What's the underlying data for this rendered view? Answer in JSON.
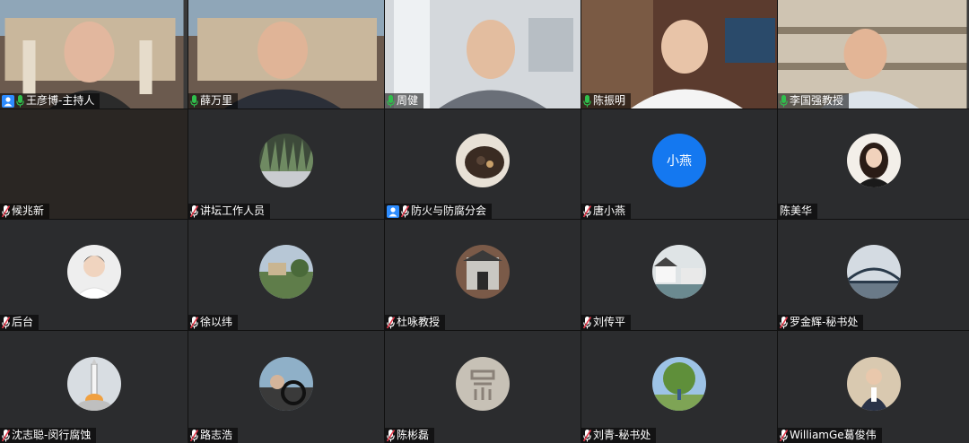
{
  "participants": [
    {
      "name": "王彦博-主持人",
      "kind": "video",
      "host": true,
      "mic": "on"
    },
    {
      "name": "薛万里",
      "kind": "video",
      "mic": "on",
      "active": true
    },
    {
      "name": "周健",
      "kind": "video",
      "mic": "on"
    },
    {
      "name": "陈振明",
      "kind": "video",
      "mic": "on"
    },
    {
      "name": "李国强教授",
      "kind": "video",
      "mic": "on"
    },
    {
      "name": "候兆新",
      "kind": "blank",
      "mic": "off"
    },
    {
      "name": "讲坛工作人员",
      "kind": "avatar",
      "avatar": "grass",
      "mic": "off"
    },
    {
      "name": "防火与防腐分会",
      "kind": "avatar",
      "avatar": "hair",
      "host": true,
      "mic": "off"
    },
    {
      "name": "唐小燕",
      "kind": "avatar",
      "avatar": "text",
      "avatar_text": "小燕",
      "mic": "off"
    },
    {
      "name": "陈美华",
      "kind": "avatar",
      "avatar": "woman",
      "mic": "none"
    },
    {
      "name": "后台",
      "kind": "avatar",
      "avatar": "man",
      "mic": "off"
    },
    {
      "name": "徐以纬",
      "kind": "avatar",
      "avatar": "park",
      "mic": "off"
    },
    {
      "name": "杜咏教授",
      "kind": "avatar",
      "avatar": "gate",
      "mic": "off"
    },
    {
      "name": "刘传平",
      "kind": "avatar",
      "avatar": "town",
      "mic": "off"
    },
    {
      "name": "罗金辉-秘书处",
      "kind": "avatar",
      "avatar": "bridge",
      "mic": "off"
    },
    {
      "name": "沈志聪-闵行腐蚀",
      "kind": "avatar",
      "avatar": "rocket",
      "mic": "off"
    },
    {
      "name": "路志浩",
      "kind": "avatar",
      "avatar": "car",
      "mic": "off"
    },
    {
      "name": "陈彬磊",
      "kind": "avatar",
      "avatar": "seal",
      "mic": "off"
    },
    {
      "name": "刘青-秘书处",
      "kind": "avatar",
      "avatar": "tree",
      "mic": "off"
    },
    {
      "name": "WilliamGe葛俊伟",
      "kind": "avatar",
      "avatar": "office",
      "mic": "off"
    }
  ],
  "colors": {
    "mic_on": "#2fbf4c",
    "mic_off": "#e0394a",
    "host_badge": "#2d8cff",
    "active_border": "#2fbf4c",
    "text_avatar_bg": "#1478f0"
  }
}
